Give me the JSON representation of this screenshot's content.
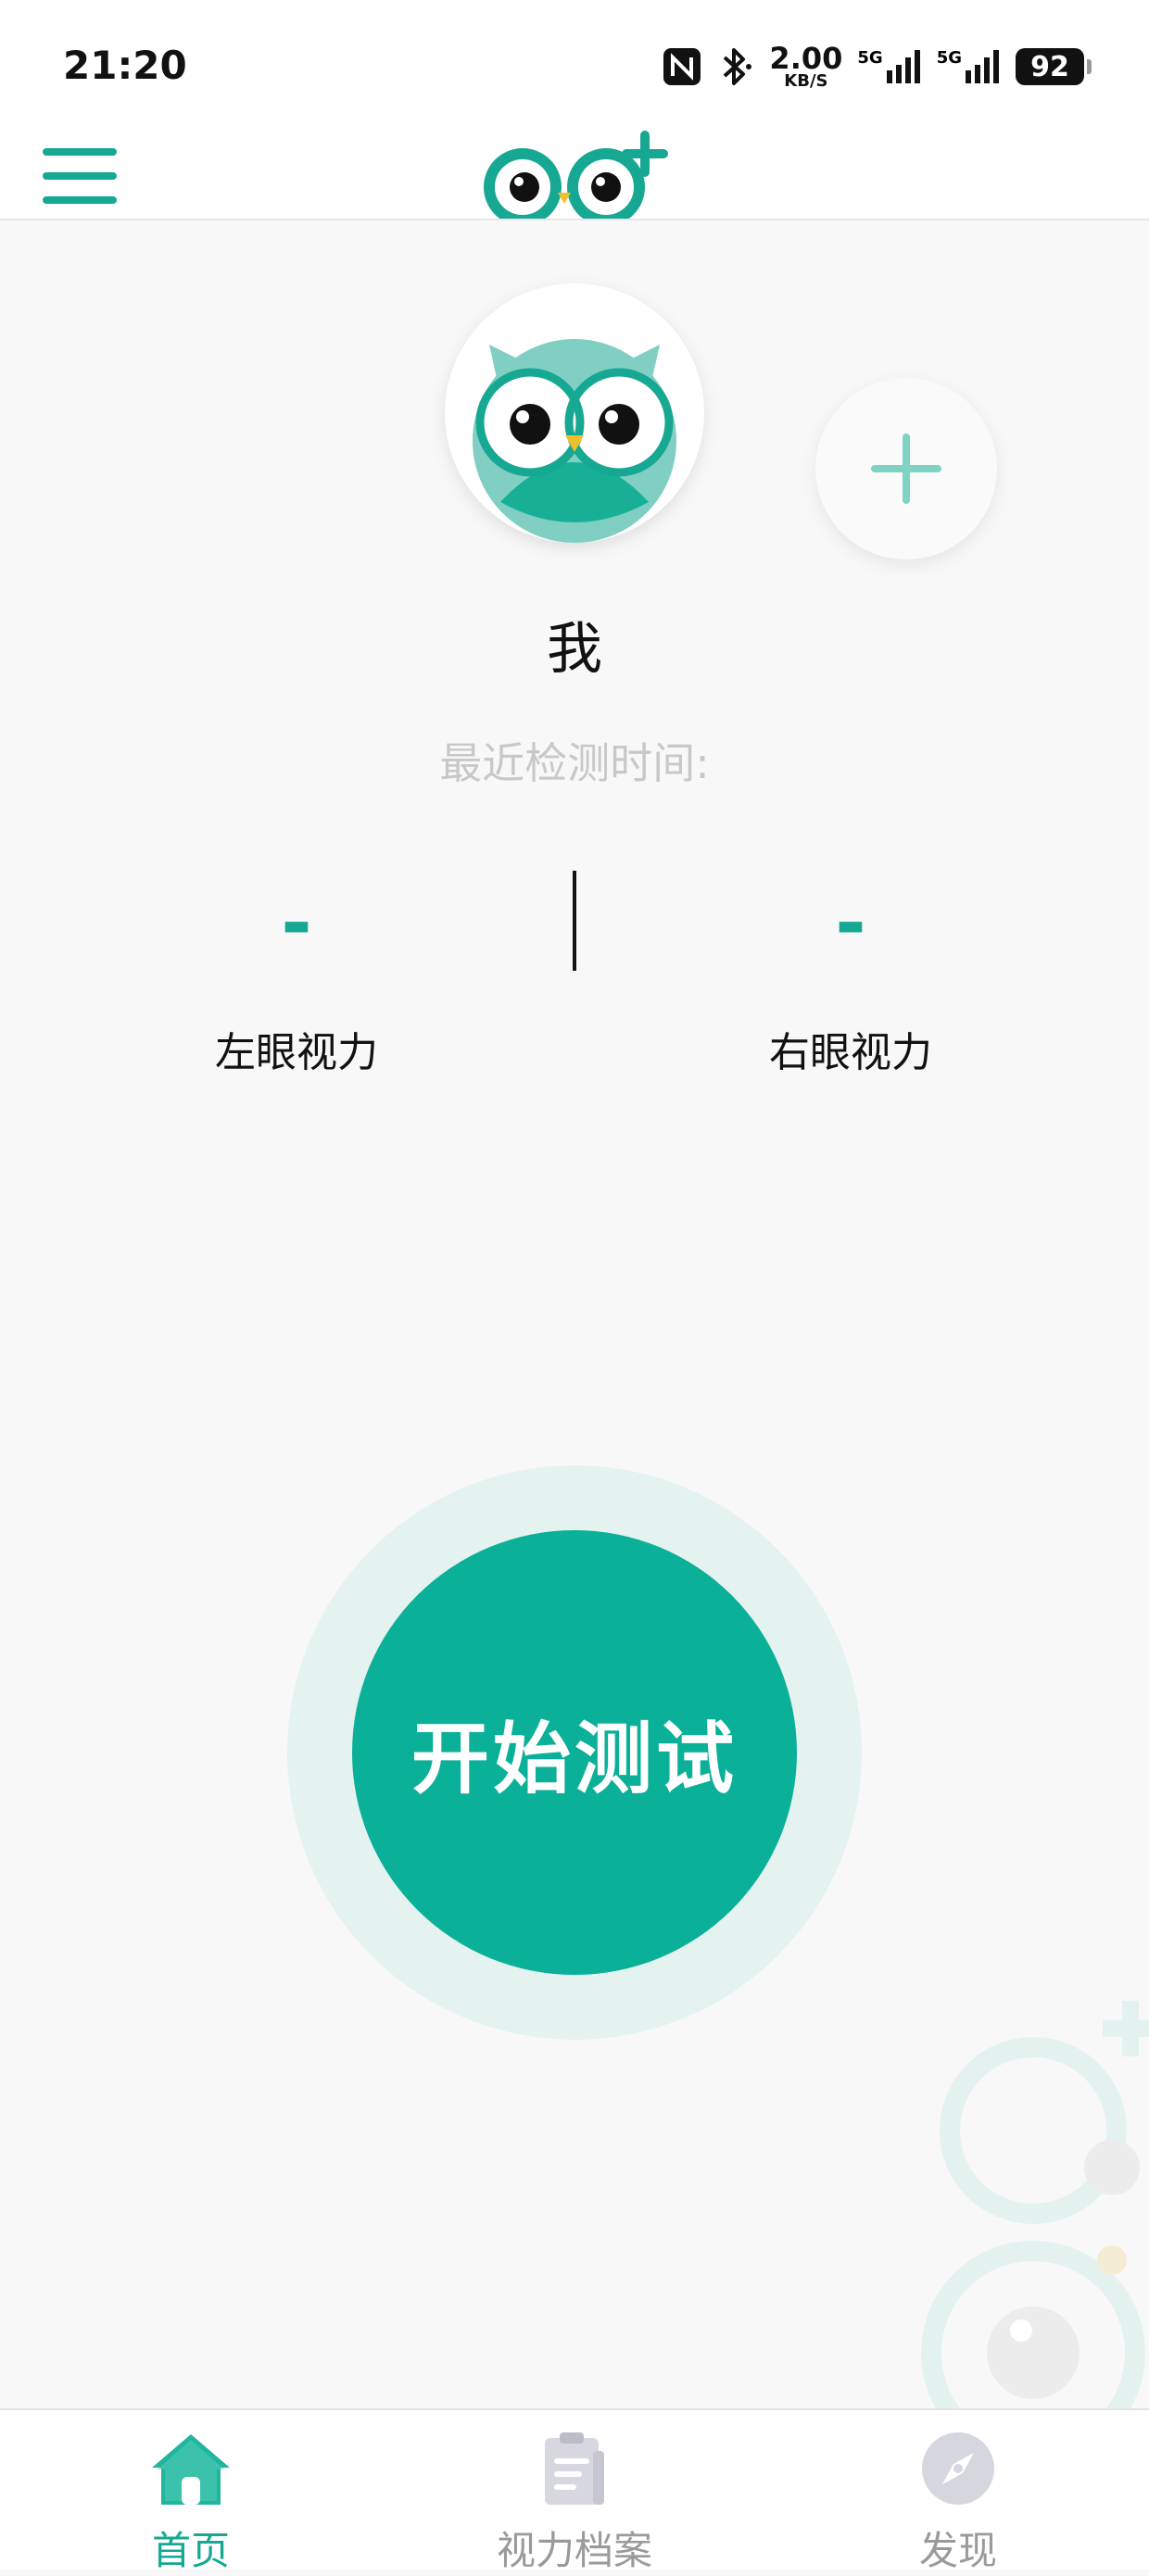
{
  "status_bar": {
    "time": "21:20",
    "net_speed_value": "2.00",
    "net_speed_unit": "KB/S",
    "signal_1_label": "5G",
    "signal_2_label": "5G",
    "battery": "92",
    "icons": [
      "nfc-icon",
      "bluetooth-icon",
      "signal-icon",
      "signal-icon",
      "battery-icon"
    ]
  },
  "header": {
    "menu_icon": "hamburger-menu-icon",
    "logo_icon": "owl-logo-icon"
  },
  "profile": {
    "avatar_icon": "owl-avatar-icon",
    "name": "我",
    "last_test_label": "最近检测时间:",
    "add_icon": "plus-icon"
  },
  "vision": {
    "left_value": "-",
    "left_label": "左眼视力",
    "right_value": "-",
    "right_label": "右眼视力"
  },
  "start_button": {
    "label": "开始测试"
  },
  "tabs": [
    {
      "label": "首页",
      "icon": "home-icon",
      "active": true
    },
    {
      "label": "视力档案",
      "icon": "clipboard-icon",
      "active": false
    },
    {
      "label": "发现",
      "icon": "compass-icon",
      "active": false
    }
  ],
  "colors": {
    "brand": "#16a892",
    "button": "#0ab098",
    "button_ring": "#e4f2f0",
    "muted_text": "#c8c8c8",
    "inactive_tab": "#9a9a9a"
  }
}
